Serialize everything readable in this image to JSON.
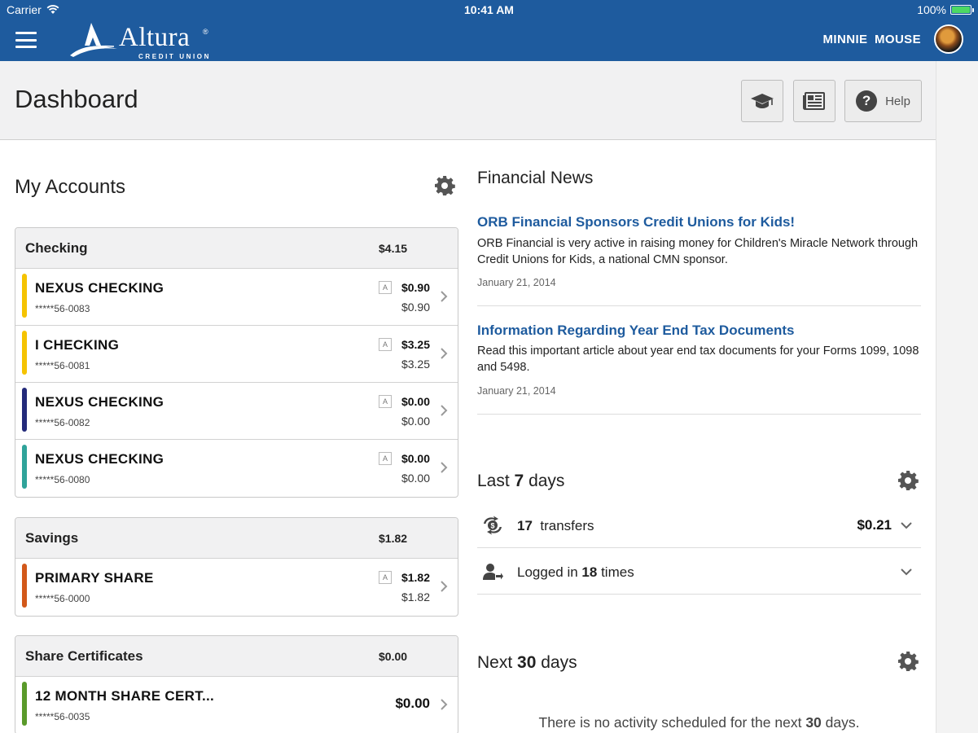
{
  "status_bar": {
    "carrier": "Carrier",
    "time": "10:41 AM",
    "battery": "100%"
  },
  "header": {
    "brand": "Altura",
    "brand_reg": "®",
    "brand_sub": "CREDIT UNION",
    "user_name": "MINNIE MOUSE"
  },
  "page": {
    "title": "Dashboard",
    "help_label": "Help"
  },
  "accounts": {
    "title": "My Accounts",
    "groups": [
      {
        "name": "Checking",
        "total": "$4.15",
        "items": [
          {
            "name": "NEXUS CHECKING",
            "number": "*****56-0083",
            "available": "$0.90",
            "balance": "$0.90",
            "color": "#f5c300",
            "badge": "A"
          },
          {
            "name": "I CHECKING",
            "number": "*****56-0081",
            "available": "$3.25",
            "balance": "$3.25",
            "color": "#f5c300",
            "badge": "A"
          },
          {
            "name": "NEXUS CHECKING",
            "number": "*****56-0082",
            "available": "$0.00",
            "balance": "$0.00",
            "color": "#232a7a",
            "badge": "A"
          },
          {
            "name": "NEXUS CHECKING",
            "number": "*****56-0080",
            "available": "$0.00",
            "balance": "$0.00",
            "color": "#2fa39a",
            "badge": "A"
          }
        ]
      },
      {
        "name": "Savings",
        "total": "$1.82",
        "items": [
          {
            "name": "PRIMARY SHARE",
            "number": "*****56-0000",
            "available": "$1.82",
            "balance": "$1.82",
            "color": "#d2581a",
            "badge": "A"
          }
        ]
      },
      {
        "name": "Share Certificates",
        "total": "$0.00",
        "items": [
          {
            "name": "12 MONTH SHARE CERT...",
            "number": "*****56-0035",
            "amount": "$0.00",
            "color": "#5a9a2a"
          }
        ]
      }
    ]
  },
  "news": {
    "title": "Financial News",
    "items": [
      {
        "headline": "ORB Financial Sponsors Credit Unions for Kids!",
        "body": "ORB Financial is very active in raising money for Children's Miracle Network through Credit Unions for Kids, a national CMN sponsor.",
        "date": "January 21, 2014"
      },
      {
        "headline": "Information Regarding Year End Tax Documents",
        "body": "Read this important article about year end tax documents for your Forms 1099, 1098 and 5498.",
        "date": "January 21, 2014"
      }
    ]
  },
  "last_days": {
    "prefix": "Last",
    "count": "7",
    "suffix": "days",
    "transfers_count": "17",
    "transfers_label": "transfers",
    "transfers_amount": "$0.21",
    "logged_prefix": "Logged in",
    "logged_count": "18",
    "logged_suffix": "times"
  },
  "next_days": {
    "prefix": "Next",
    "count": "30",
    "suffix": "days",
    "empty_prefix": "There is no activity scheduled for the next",
    "empty_count": "30",
    "empty_suffix": "days."
  },
  "colors": {
    "brand_blue": "#1e5b9e",
    "link_blue": "#1e5b9e",
    "header_gray": "#f1f1f2"
  },
  "icons": [
    "wifi-icon",
    "battery-icon",
    "menu-icon",
    "graduation-cap-icon",
    "newspaper-icon",
    "help-icon",
    "gear-icon",
    "chevron-right-icon",
    "chevron-down-icon",
    "transfer-icon",
    "user-login-icon"
  ]
}
